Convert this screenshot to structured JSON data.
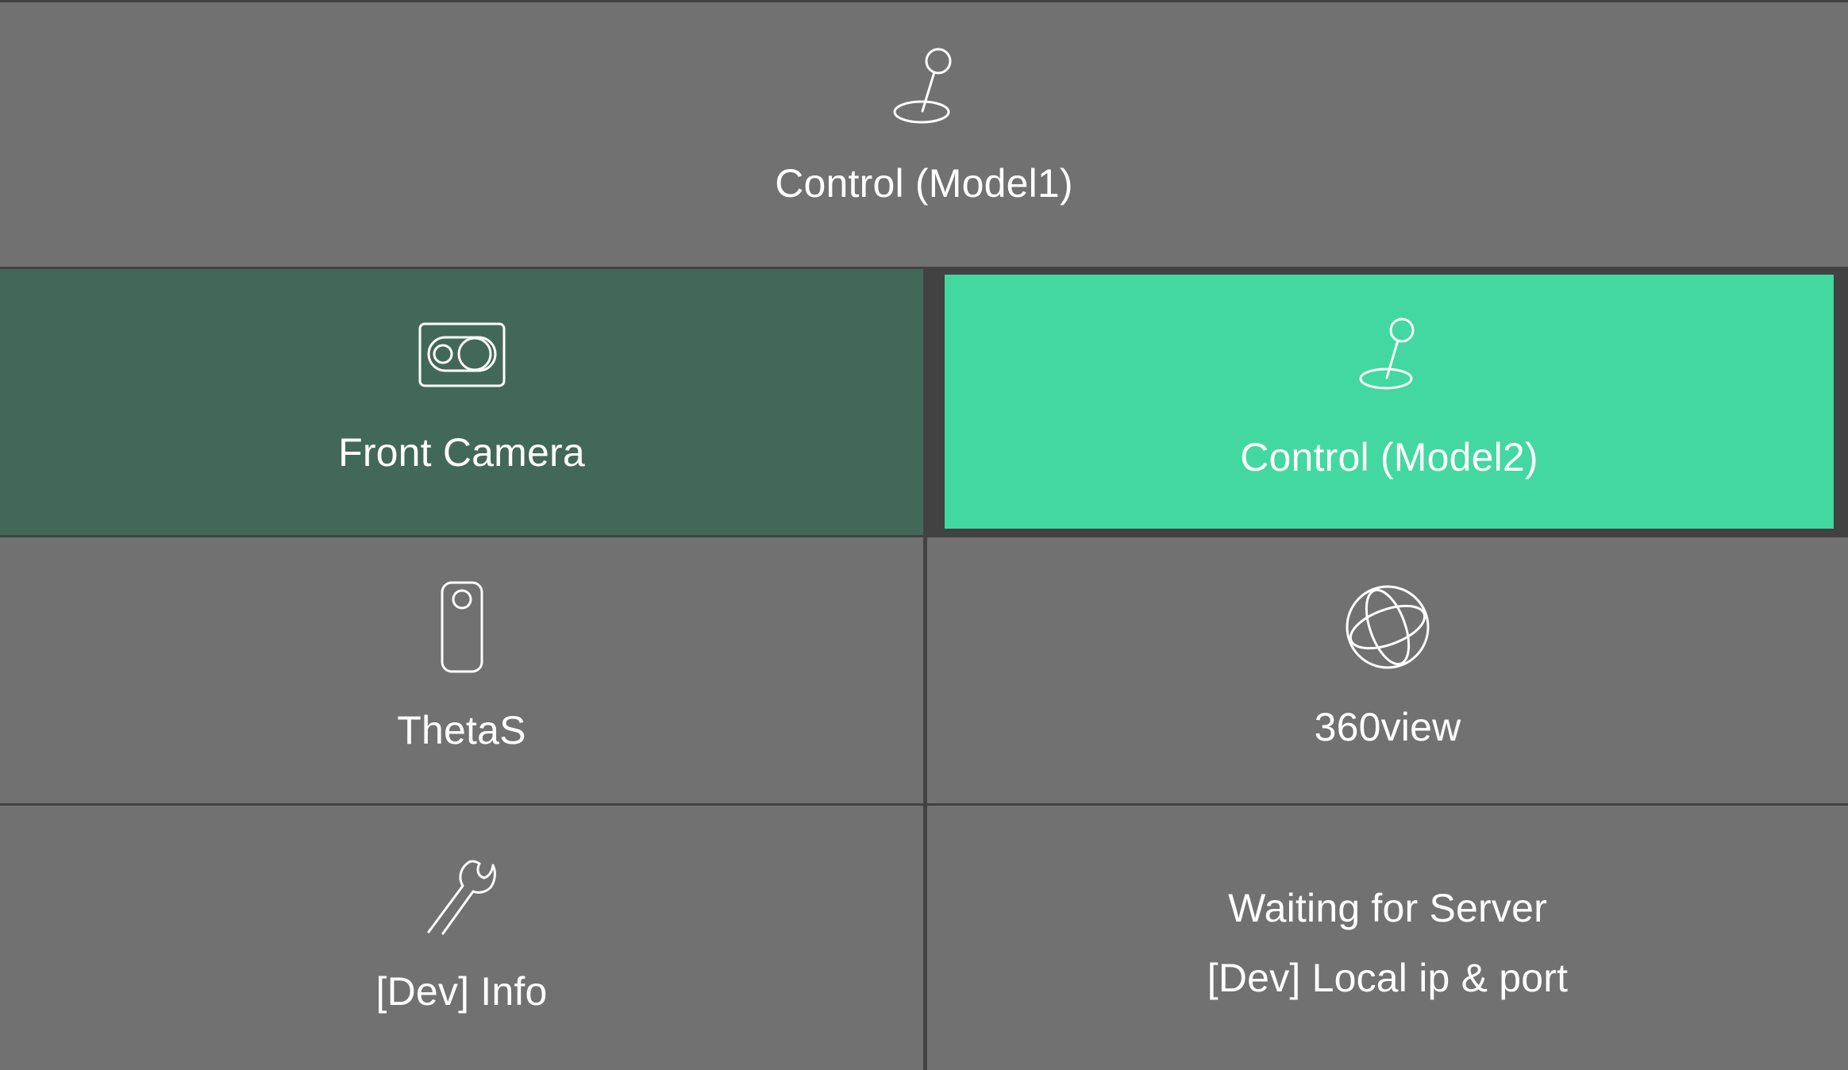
{
  "colors": {
    "tile_background": "#717171",
    "grid_lines": "#424242",
    "front_camera_background": "#426859",
    "active_tile_background": "#43d89f",
    "text": "#ffffff"
  },
  "tiles": {
    "control_model1": {
      "label": "Control (Model1)",
      "icon": "joystick-icon"
    },
    "front_camera": {
      "label": "Front Camera",
      "icon": "camera-icon"
    },
    "control_model2": {
      "label": "Control (Model2)",
      "icon": "joystick-icon",
      "selected": true
    },
    "thetas": {
      "label": "ThetaS",
      "icon": "theta-camera-icon"
    },
    "view360": {
      "label": "360view",
      "icon": "globe-icon"
    },
    "dev_info": {
      "label": "[Dev] Info",
      "icon": "wrench-icon"
    },
    "server_status": {
      "line1": "Waiting for Server",
      "line2": "[Dev] Local ip & port"
    }
  }
}
